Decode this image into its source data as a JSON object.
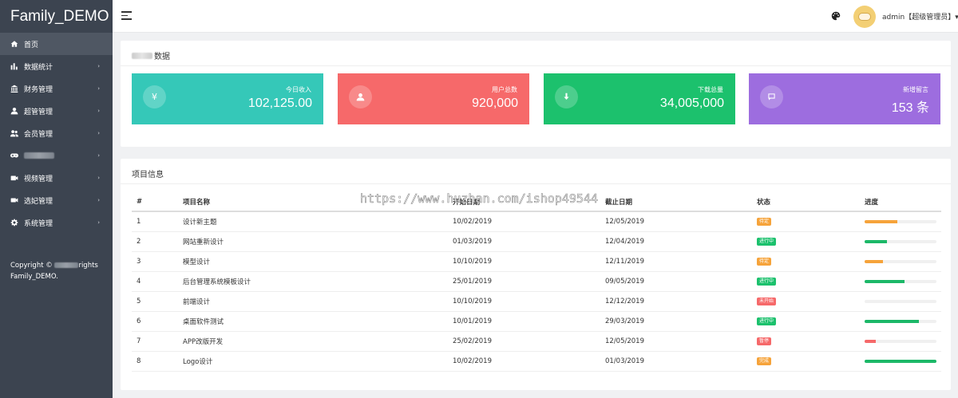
{
  "app": {
    "brand": "Family_DEMO"
  },
  "sidebar": {
    "items": [
      {
        "label": "首页",
        "icon": "home-icon",
        "active": true,
        "chevron": ""
      },
      {
        "label": "数据统计",
        "icon": "bar-chart-icon",
        "active": false,
        "chevron": "›"
      },
      {
        "label": "财务管理",
        "icon": "bank-icon",
        "active": false,
        "chevron": "›"
      },
      {
        "label": "超管管理",
        "icon": "user-icon",
        "active": false,
        "chevron": "›"
      },
      {
        "label": "会员管理",
        "icon": "users-icon",
        "active": false,
        "chevron": "›"
      },
      {
        "label": "",
        "icon": "gamepad-icon",
        "active": false,
        "chevron": "›"
      },
      {
        "label": "视频管理",
        "icon": "video-icon",
        "active": false,
        "chevron": "›"
      },
      {
        "label": "选妃管理",
        "icon": "video-camera-icon",
        "active": false,
        "chevron": "›"
      },
      {
        "label": "系统管理",
        "icon": "gear-icon",
        "active": false,
        "chevron": "›"
      }
    ],
    "copyright_prefix": "Copyright ©",
    "copyright_suffix": "rights",
    "copyright_line2": "Family_DEMO."
  },
  "topbar": {
    "user": "admin【超级管理员】▾"
  },
  "stats": {
    "title_suffix": "数据",
    "cards": [
      {
        "label": "今日收入",
        "value": "102,125.00",
        "icon": "yen-icon",
        "glyph": "¥",
        "color": "#35c8b8"
      },
      {
        "label": "用户总数",
        "value": "920,000",
        "icon": "user-icon",
        "glyph": "",
        "color": "#f6696a"
      },
      {
        "label": "下载总量",
        "value": "34,005,000",
        "icon": "download-icon",
        "glyph": "",
        "color": "#1cc16d"
      },
      {
        "label": "新增留言",
        "value": "153 条",
        "icon": "message-icon",
        "glyph": "",
        "color": "#9d6ddf"
      }
    ]
  },
  "projects": {
    "title": "项目信息",
    "watermark": "https://www.huzhan.com/ishop49544",
    "headers": [
      "#",
      "项目名称",
      "开始日期",
      "截止日期",
      "状态",
      "进度"
    ],
    "rows": [
      {
        "num": "1",
        "name": "设计新主题",
        "start": "10/02/2019",
        "end": "12/05/2019",
        "status": "待定",
        "status_color": "#f6a33a",
        "progress": 0.46,
        "bar_color": "#f6a33a"
      },
      {
        "num": "2",
        "name": "网站重新设计",
        "start": "01/03/2019",
        "end": "12/04/2019",
        "status": "进行中",
        "status_color": "#1cc16d",
        "progress": 0.31,
        "bar_color": "#1cb868"
      },
      {
        "num": "3",
        "name": "模型设计",
        "start": "10/10/2019",
        "end": "12/11/2019",
        "status": "待定",
        "status_color": "#f6a33a",
        "progress": 0.26,
        "bar_color": "#f6a33a"
      },
      {
        "num": "4",
        "name": "后台管理系统模板设计",
        "start": "25/01/2019",
        "end": "09/05/2019",
        "status": "进行中",
        "status_color": "#1cc16d",
        "progress": 0.56,
        "bar_color": "#1cb868"
      },
      {
        "num": "5",
        "name": "前端设计",
        "start": "10/10/2019",
        "end": "12/12/2019",
        "status": "未开始",
        "status_color": "#f6696a",
        "progress": 0,
        "bar_color": "#f6696a"
      },
      {
        "num": "6",
        "name": "桌面软件测试",
        "start": "10/01/2019",
        "end": "29/03/2019",
        "status": "进行中",
        "status_color": "#1cc16d",
        "progress": 0.76,
        "bar_color": "#1cb868"
      },
      {
        "num": "7",
        "name": "APP改版开发",
        "start": "25/02/2019",
        "end": "12/05/2019",
        "status": "暂停",
        "status_color": "#f6696a",
        "progress": 0.16,
        "bar_color": "#f6696a"
      },
      {
        "num": "8",
        "name": "Logo设计",
        "start": "10/02/2019",
        "end": "01/03/2019",
        "status": "完成",
        "status_color": "#f6a33a",
        "progress": 1.0,
        "bar_color": "#1cb868"
      }
    ]
  }
}
